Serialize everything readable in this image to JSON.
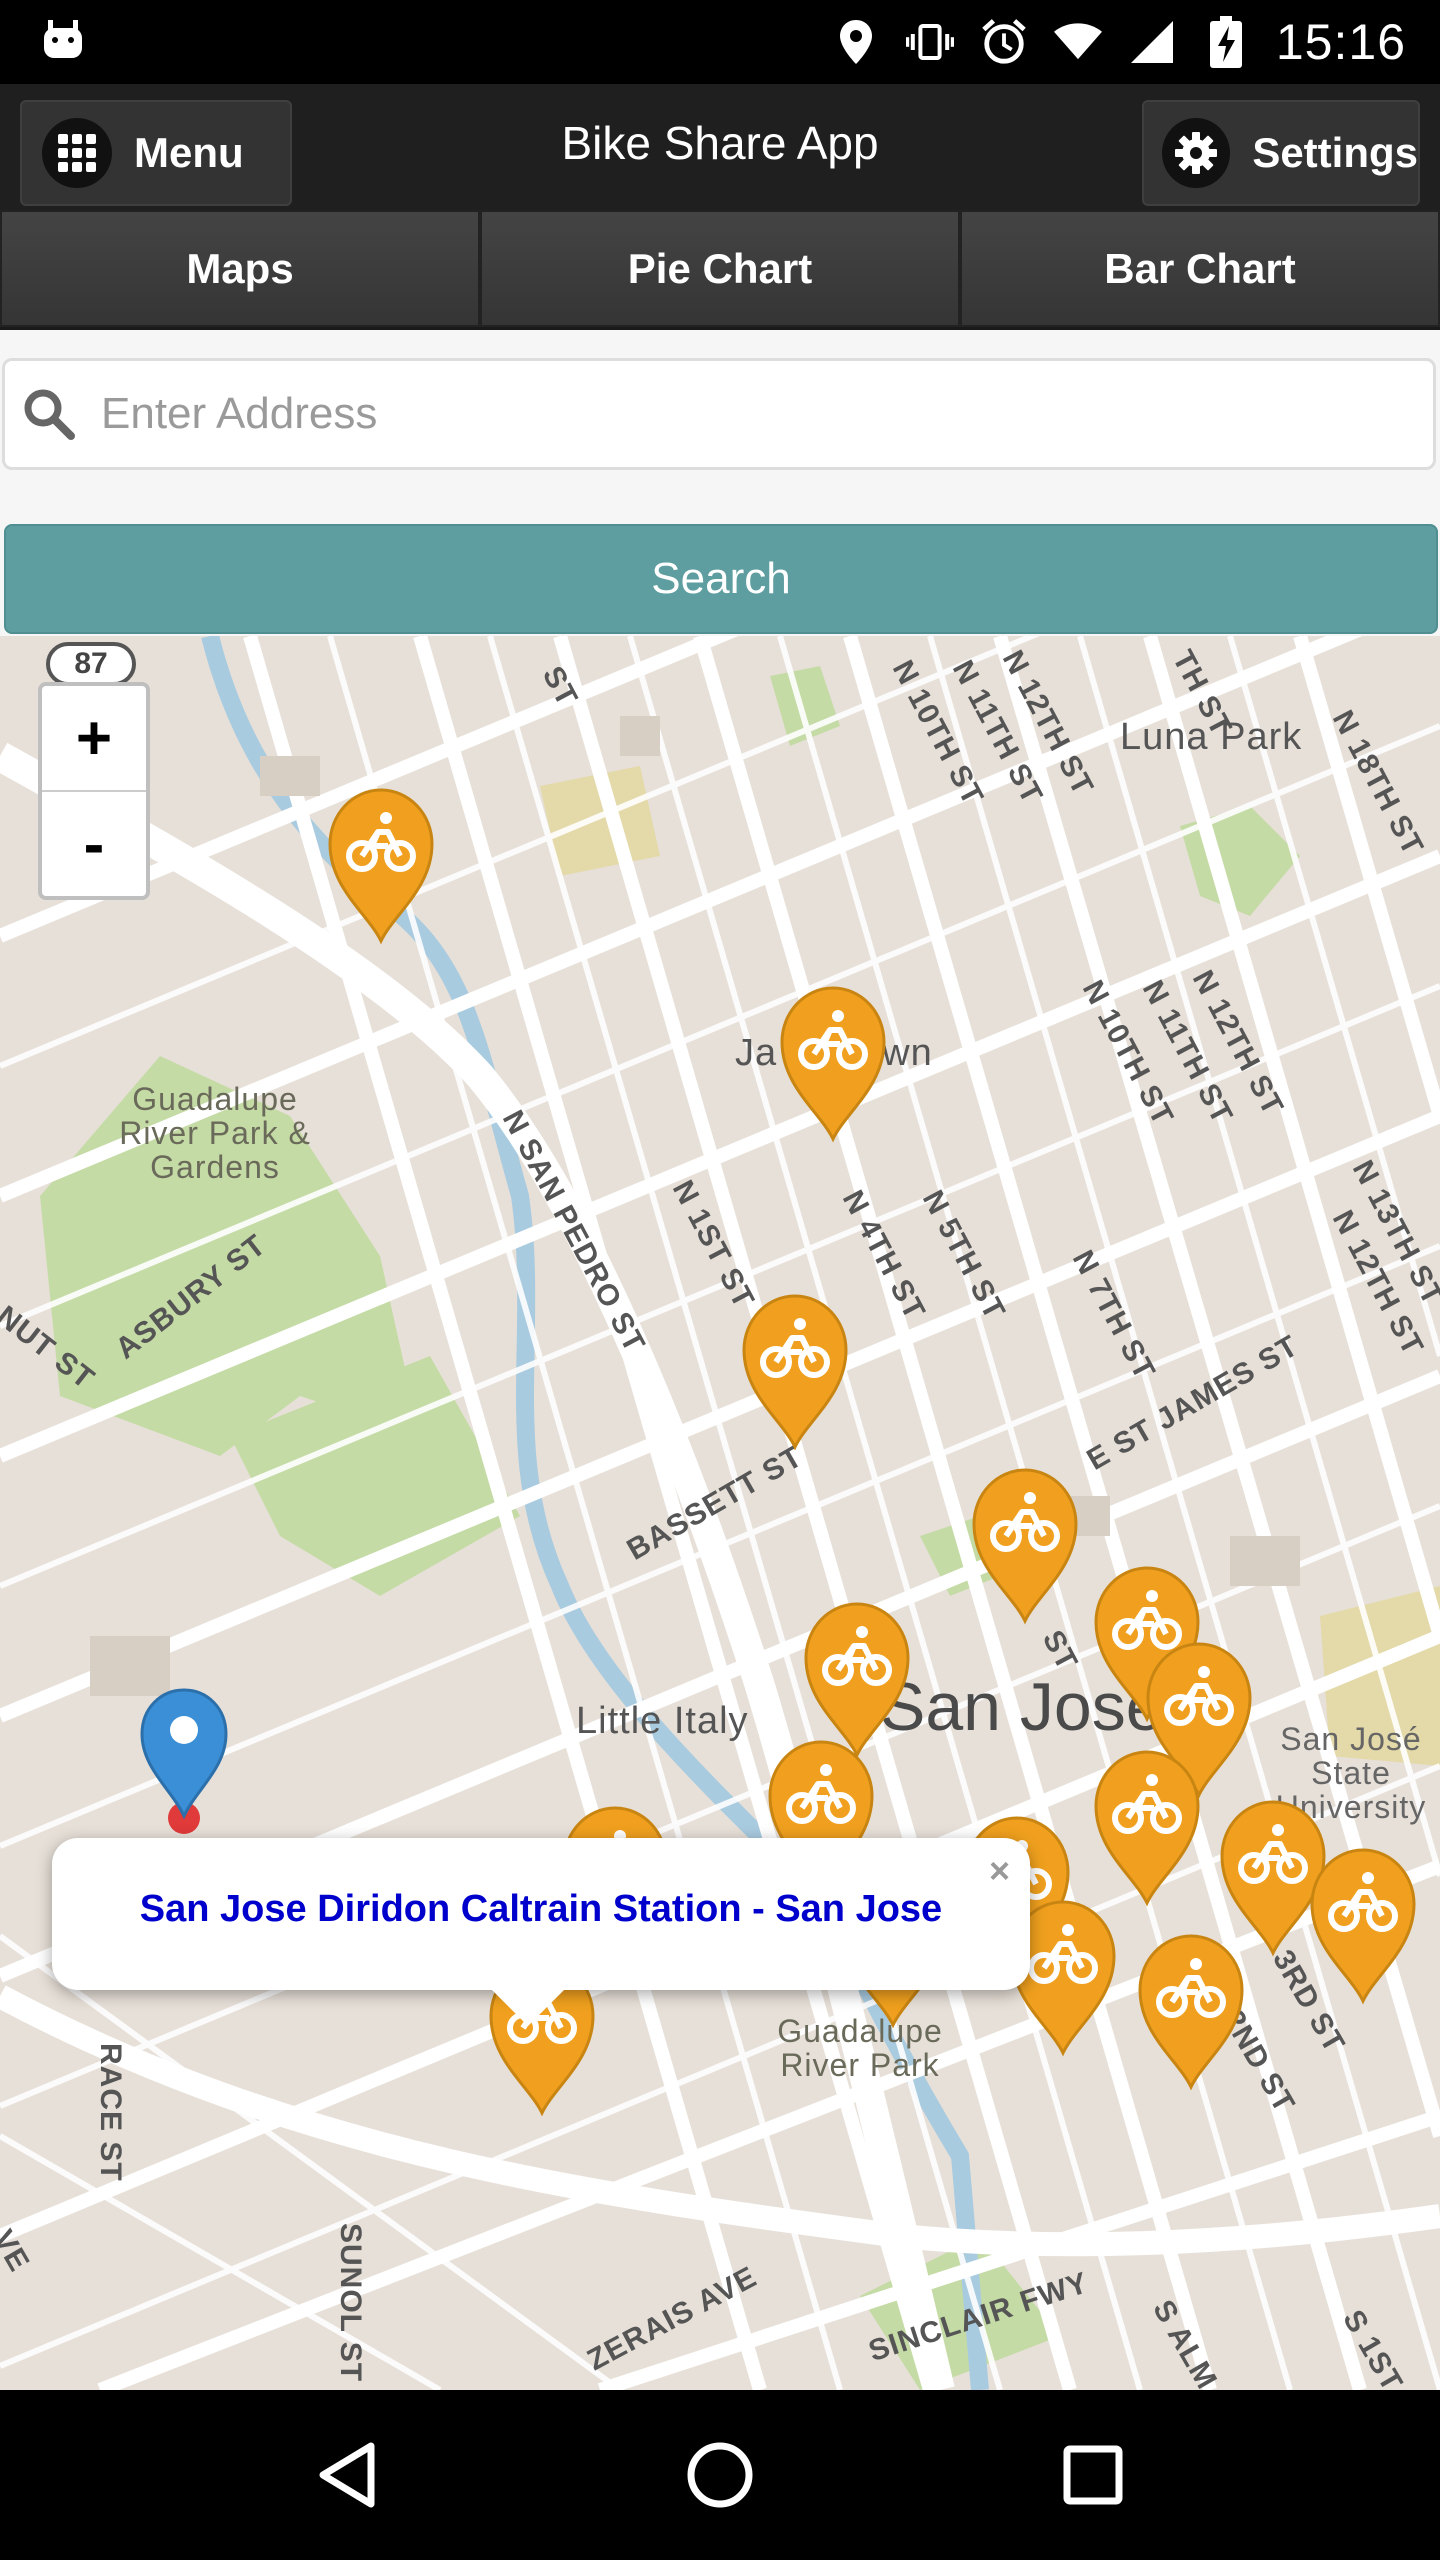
{
  "status_bar": {
    "time": "15:16"
  },
  "header": {
    "title": "Bike Share App",
    "menu_label": "Menu",
    "settings_label": "Settings"
  },
  "tabs": [
    {
      "label": "Maps"
    },
    {
      "label": "Pie Chart"
    },
    {
      "label": "Bar Chart"
    }
  ],
  "search": {
    "placeholder": "Enter Address",
    "button_label": "Search"
  },
  "map": {
    "highway_shield": "87",
    "zoom_in": "+",
    "zoom_out": "-",
    "labels": {
      "luna_park": "Luna Park",
      "japantown_left": "Ja",
      "japantown_right": "own",
      "guadalupe_gardens": "Guadalupe River Park & Gardens",
      "asbury": "ASBURY ST",
      "nut": "NUT ST",
      "n_san_pedro": "N SAN PEDRO ST",
      "n_1st": "N 1ST ST",
      "n_4th": "N 4TH ST",
      "n_5th": "N 5TH ST",
      "n_7th": "N 7TH ST",
      "n_10th_top": "N 10TH ST",
      "n_11th_top": "N 11TH ST",
      "n_12th_top": "N 12TH ST",
      "n_10th": "N 10TH ST",
      "n_11th": "N 11TH ST",
      "n_12th": "N 12TH ST",
      "n_13th": "N 13TH ST",
      "n_12th_right": "N 12TH ST",
      "n_18th": "N 18TH ST",
      "e_st_james": "E ST JAMES ST",
      "bassett": "BASSETT ST",
      "little_italy": "Little Italy",
      "san_jose": "San Jose",
      "sjsu": "San José State University",
      "guadalupe_river_park": "Guadalupe River Park",
      "race": "RACE ST",
      "sunol": "SUNOL ST",
      "zerais": "ZERAIS AVE",
      "sinclair": "SINCLAIR FWY",
      "third": "3RD ST",
      "second": "2ND ST",
      "s_alm": "S ALM",
      "s_1st": "S 1ST",
      "ve": "VE",
      "st_top": "ST",
      "th_st": "TH ST",
      "st_mid": "ST"
    },
    "popup_text": "San Jose Diridon Caltrain Station - San Jose",
    "popup_close": "×",
    "colors": {
      "bike_marker": "#f0a01e",
      "location_pin": "#3a8fd6",
      "park": "#c5dba5",
      "water": "#a9cbe0"
    },
    "bike_station_count_visible": 19
  }
}
